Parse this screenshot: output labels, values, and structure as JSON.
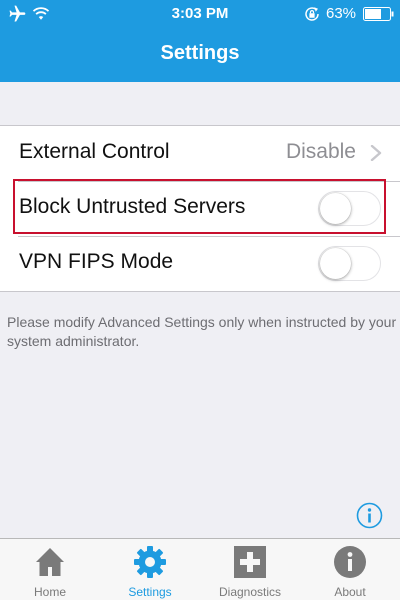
{
  "status_bar": {
    "time": "3:03 PM",
    "battery_percent": "63%",
    "icons": [
      "airplane-icon",
      "wifi-icon",
      "rotation-lock-icon",
      "battery-icon"
    ]
  },
  "nav": {
    "title": "Settings"
  },
  "settings": {
    "rows": [
      {
        "label": "External Control",
        "value": "Disable",
        "control": "disclosure"
      },
      {
        "label": "Block Untrusted Servers",
        "control": "toggle",
        "on": false
      },
      {
        "label": "VPN FIPS Mode",
        "control": "toggle",
        "on": false
      }
    ],
    "footnote": "Please modify Advanced Settings only when instructed by your system administrator."
  },
  "tabs": [
    {
      "label": "Home",
      "icon": "home-icon",
      "selected": false
    },
    {
      "label": "Settings",
      "icon": "gear-icon",
      "selected": true
    },
    {
      "label": "Diagnostics",
      "icon": "plus-icon",
      "selected": false
    },
    {
      "label": "About",
      "icon": "info-icon",
      "selected": false
    }
  ],
  "colors": {
    "accent": "#1e9be0",
    "background": "#efeff4",
    "highlight": "#c8102e",
    "tab_inactive": "#7a7a7a"
  }
}
